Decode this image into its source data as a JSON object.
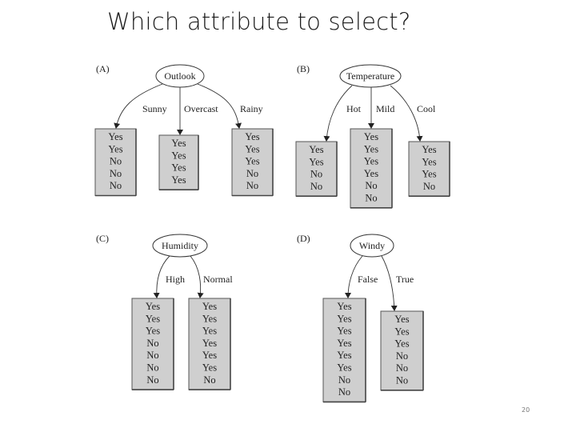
{
  "slide": {
    "title": "Which attribute to select?",
    "page_number": "20"
  },
  "panels": [
    {
      "label": "(A)",
      "attribute": "Outlook",
      "branches": [
        {
          "value": "Sunny",
          "outcomes": [
            "Yes",
            "Yes",
            "No",
            "No",
            "No"
          ]
        },
        {
          "value": "Overcast",
          "outcomes": [
            "Yes",
            "Yes",
            "Yes",
            "Yes"
          ]
        },
        {
          "value": "Rainy",
          "outcomes": [
            "Yes",
            "Yes",
            "Yes",
            "No",
            "No"
          ]
        }
      ]
    },
    {
      "label": "(B)",
      "attribute": "Temperature",
      "branches": [
        {
          "value": "Hot",
          "outcomes": [
            "Yes",
            "Yes",
            "No",
            "No"
          ]
        },
        {
          "value": "Mild",
          "outcomes": [
            "Yes",
            "Yes",
            "Yes",
            "Yes",
            "No",
            "No"
          ]
        },
        {
          "value": "Cool",
          "outcomes": [
            "Yes",
            "Yes",
            "Yes",
            "No"
          ]
        }
      ]
    },
    {
      "label": "(C)",
      "attribute": "Humidity",
      "branches": [
        {
          "value": "High",
          "outcomes": [
            "Yes",
            "Yes",
            "Yes",
            "No",
            "No",
            "No",
            "No"
          ]
        },
        {
          "value": "Normal",
          "outcomes": [
            "Yes",
            "Yes",
            "Yes",
            "Yes",
            "Yes",
            "Yes",
            "No"
          ]
        }
      ]
    },
    {
      "label": "(D)",
      "attribute": "Windy",
      "branches": [
        {
          "value": "False",
          "outcomes": [
            "Yes",
            "Yes",
            "Yes",
            "Yes",
            "Yes",
            "Yes",
            "No",
            "No"
          ]
        },
        {
          "value": "True",
          "outcomes": [
            "Yes",
            "Yes",
            "Yes",
            "No",
            "No",
            "No"
          ]
        }
      ]
    }
  ]
}
